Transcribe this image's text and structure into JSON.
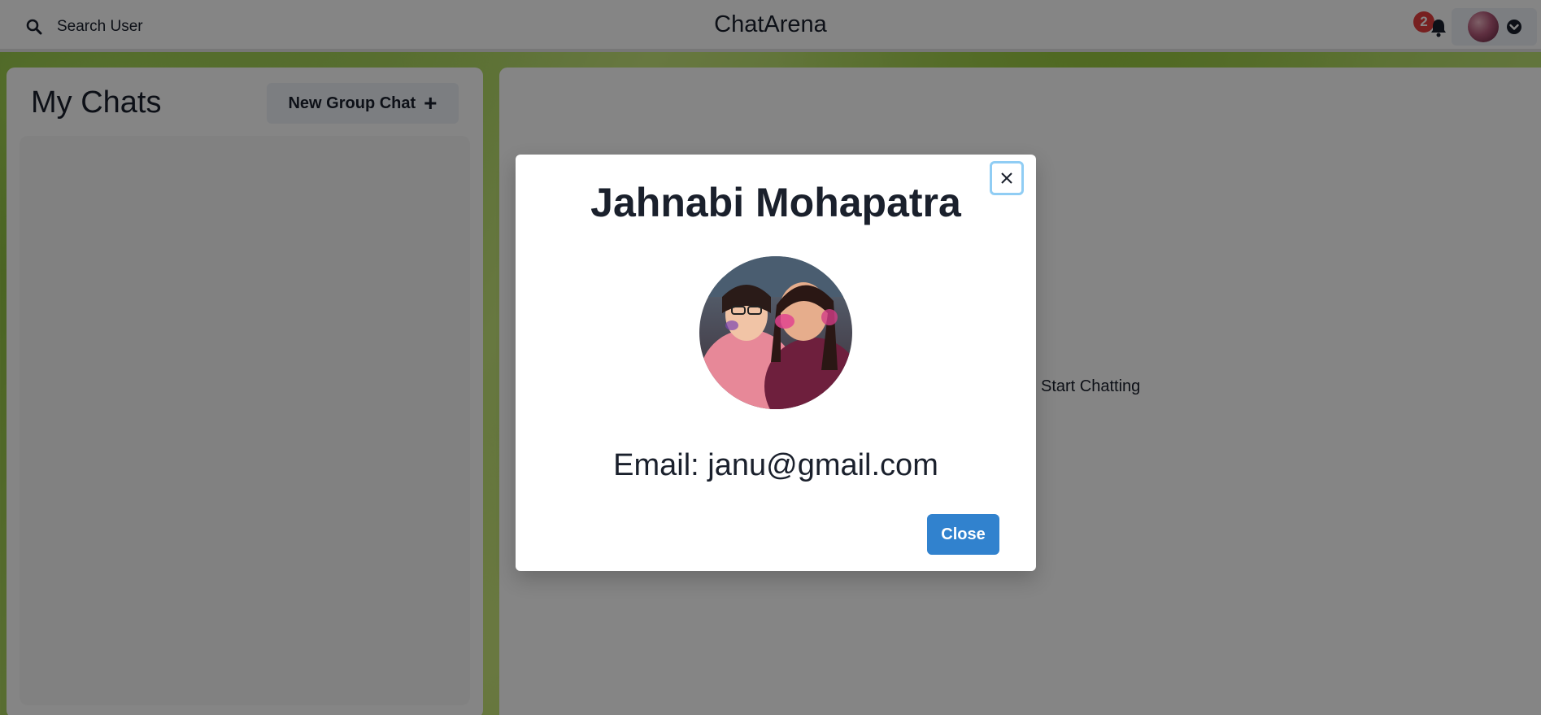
{
  "header": {
    "search_label": "Search User",
    "app_title": "ChatArena",
    "notification_count": "2"
  },
  "sidebar": {
    "title": "My Chats",
    "new_group_label": "New Group Chat",
    "new_group_icon": "plus-icon"
  },
  "chat_box": {
    "placeholder": "Start Chatting"
  },
  "modal": {
    "name": "Jahnabi Mohapatra",
    "email_text": "Email: janu@gmail.com",
    "close_label": "Close"
  },
  "colors": {
    "primary_button": "#3182ce",
    "badge": "#e53e3e",
    "focus_ring": "#90cdf4"
  }
}
